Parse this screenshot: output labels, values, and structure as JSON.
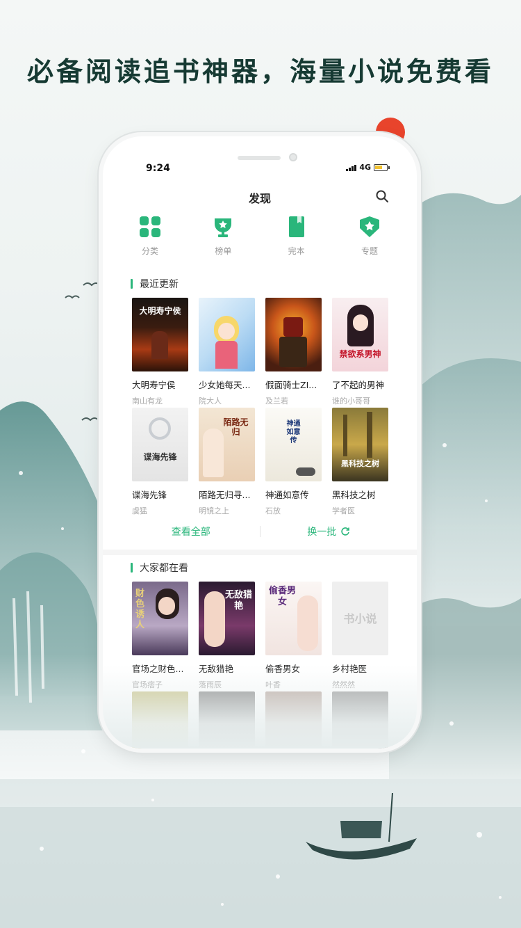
{
  "headline": "必备阅读追书神器，海量小说免费看",
  "status": {
    "time": "9:24",
    "network": "4G"
  },
  "nav": {
    "title": "发现"
  },
  "categories": [
    {
      "label": "分类",
      "icon": "grid-icon"
    },
    {
      "label": "榜单",
      "icon": "trophy-icon"
    },
    {
      "label": "完本",
      "icon": "book-icon"
    },
    {
      "label": "专题",
      "icon": "star-badge-icon"
    }
  ],
  "recent": {
    "title": "最近更新",
    "books": [
      {
        "title": "大明寿宁侯",
        "author": "南山有龙",
        "cover_text": "大明寿宁侯"
      },
      {
        "title": "少女她每天...",
        "author": "院大人",
        "cover_text": ""
      },
      {
        "title": "假面骑士ZI...",
        "author": "及兰若",
        "cover_text": ""
      },
      {
        "title": "了不起的男神",
        "author": "谁的小哥哥",
        "cover_text": "禁欲系男神"
      },
      {
        "title": "谍海先锋",
        "author": "虞猛",
        "cover_text": "谍海先锋"
      },
      {
        "title": "陌路无归寻...",
        "author": "明镜之上",
        "cover_text": "陌路无归"
      },
      {
        "title": "神通如意传",
        "author": "石放",
        "cover_text": "神通如意传"
      },
      {
        "title": "黑科技之树",
        "author": "学者医",
        "cover_text": "黑科技之树"
      }
    ],
    "view_all": "查看全部",
    "refresh": "换一批"
  },
  "popular": {
    "title": "大家都在看",
    "books": [
      {
        "title": "官场之财色...",
        "author": "官场痞子",
        "cover_text": "财色诱人"
      },
      {
        "title": "无敌猎艳",
        "author": "落雨辰",
        "cover_text": "无敌猎艳"
      },
      {
        "title": "偷香男女",
        "author": "叶香",
        "cover_text": "偷香男女"
      },
      {
        "title": "乡村艳医",
        "author": "然然然",
        "cover_text": "书小说"
      }
    ]
  },
  "colors": {
    "accent": "#2ab67b",
    "ink": "#163a33",
    "sun": "#e8442c"
  }
}
